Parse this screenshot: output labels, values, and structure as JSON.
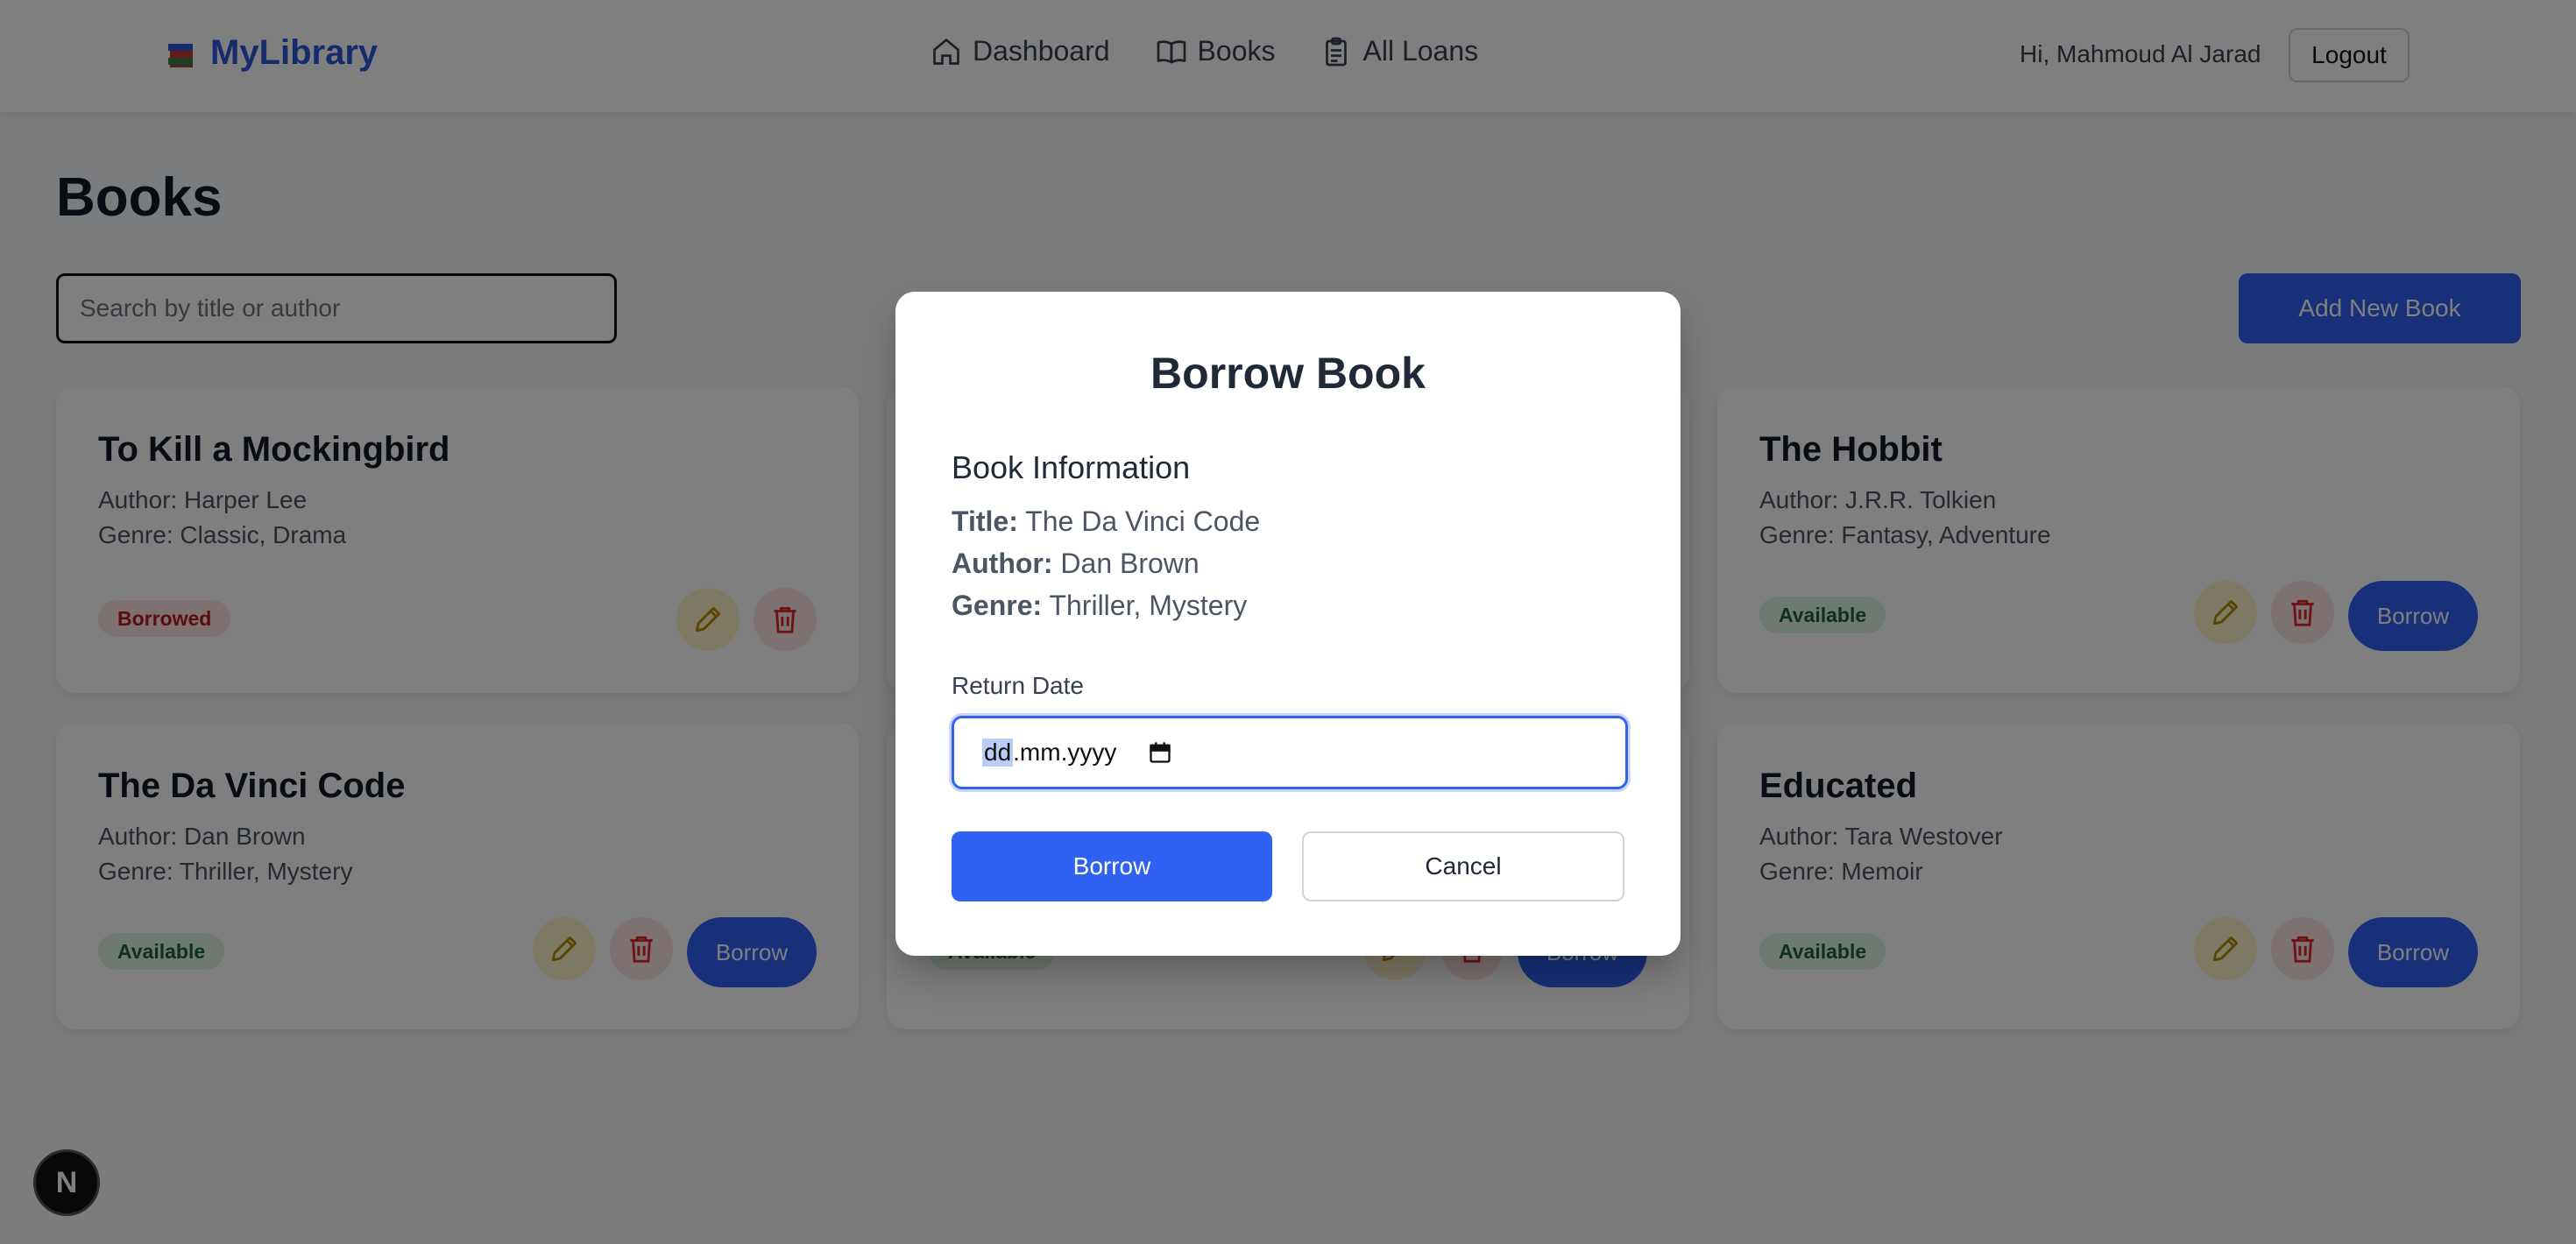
{
  "header": {
    "brand": "MyLibrary",
    "brand_icon": "books-icon",
    "nav": [
      {
        "label": "Dashboard",
        "icon": "home-icon"
      },
      {
        "label": "Books",
        "icon": "open-book-icon"
      },
      {
        "label": "All Loans",
        "icon": "clipboard-icon"
      }
    ],
    "greeting": "Hi, Mahmoud Al Jarad",
    "logout_label": "Logout"
  },
  "page": {
    "title": "Books",
    "search_placeholder": "Search by title or author",
    "add_label": "Add New Book"
  },
  "books": [
    {
      "title": "To Kill a Mockingbird",
      "author": "Author: Harper Lee",
      "genre": "Genre: Classic, Drama",
      "status": "Borrowed",
      "borrow_label": ""
    },
    {
      "title": "The Hobbit",
      "author": "Author: J.R.R. Tolkien",
      "genre": "Genre: Fantasy, Adventure",
      "status": "Available",
      "borrow_label": "Borrow"
    },
    {
      "title": "The Da Vinci Code",
      "author": "Author: Dan Brown",
      "genre": "Genre: Thriller, Mystery",
      "status": "Available",
      "borrow_label": "Borrow"
    },
    {
      "title": "Educated",
      "author": "Author: Tara Westover",
      "genre": "Genre: Memoir",
      "status": "Available",
      "borrow_label": "Borrow"
    }
  ],
  "hidden_card": {
    "status": "Available",
    "borrow_label": "Borrow"
  },
  "modal": {
    "title": "Borrow Book",
    "section": "Book Information",
    "title_label": "Title:",
    "title_value": "The Da Vinci Code",
    "author_label": "Author:",
    "author_value": "Dan Brown",
    "genre_label": "Genre:",
    "genre_value": "Thriller, Mystery",
    "field_label": "Return Date",
    "date_day": "dd",
    "date_rest": ".mm.yyyy",
    "borrow_label": "Borrow",
    "cancel_label": "Cancel"
  },
  "dev_badge": "N",
  "colors": {
    "accent": "#2f61f2",
    "brand": "#2c56d8",
    "borrowed": "#b91c1c",
    "available": "#166534"
  }
}
